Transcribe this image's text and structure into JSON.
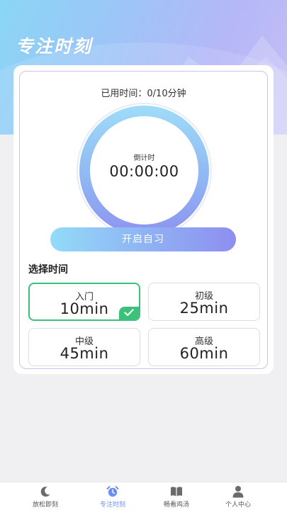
{
  "header": {
    "title": "专注时刻"
  },
  "timer": {
    "used_label": "已用时间：0/10分钟",
    "countdown_label": "倒计时",
    "countdown_value": "00:00:00",
    "start_button": "开启自习"
  },
  "selection": {
    "title": "选择时间",
    "selected_index": 0,
    "options": [
      {
        "level": "入门",
        "duration": "10min"
      },
      {
        "level": "初级",
        "duration": "25min"
      },
      {
        "level": "中级",
        "duration": "45min"
      },
      {
        "level": "高级",
        "duration": "60min"
      }
    ]
  },
  "tabbar": {
    "active_index": 1,
    "items": [
      {
        "label": "放松即刻",
        "icon": "moon-icon"
      },
      {
        "label": "专注时刻",
        "icon": "alarm-clock-icon"
      },
      {
        "label": "畅看鸡汤",
        "icon": "book-icon"
      },
      {
        "label": "个人中心",
        "icon": "person-icon"
      }
    ]
  },
  "colors": {
    "accent": "#6a8ff0",
    "selected_border": "#3cc17a",
    "gradient_start": "#93dbf8",
    "gradient_end": "#8e8ef0"
  }
}
